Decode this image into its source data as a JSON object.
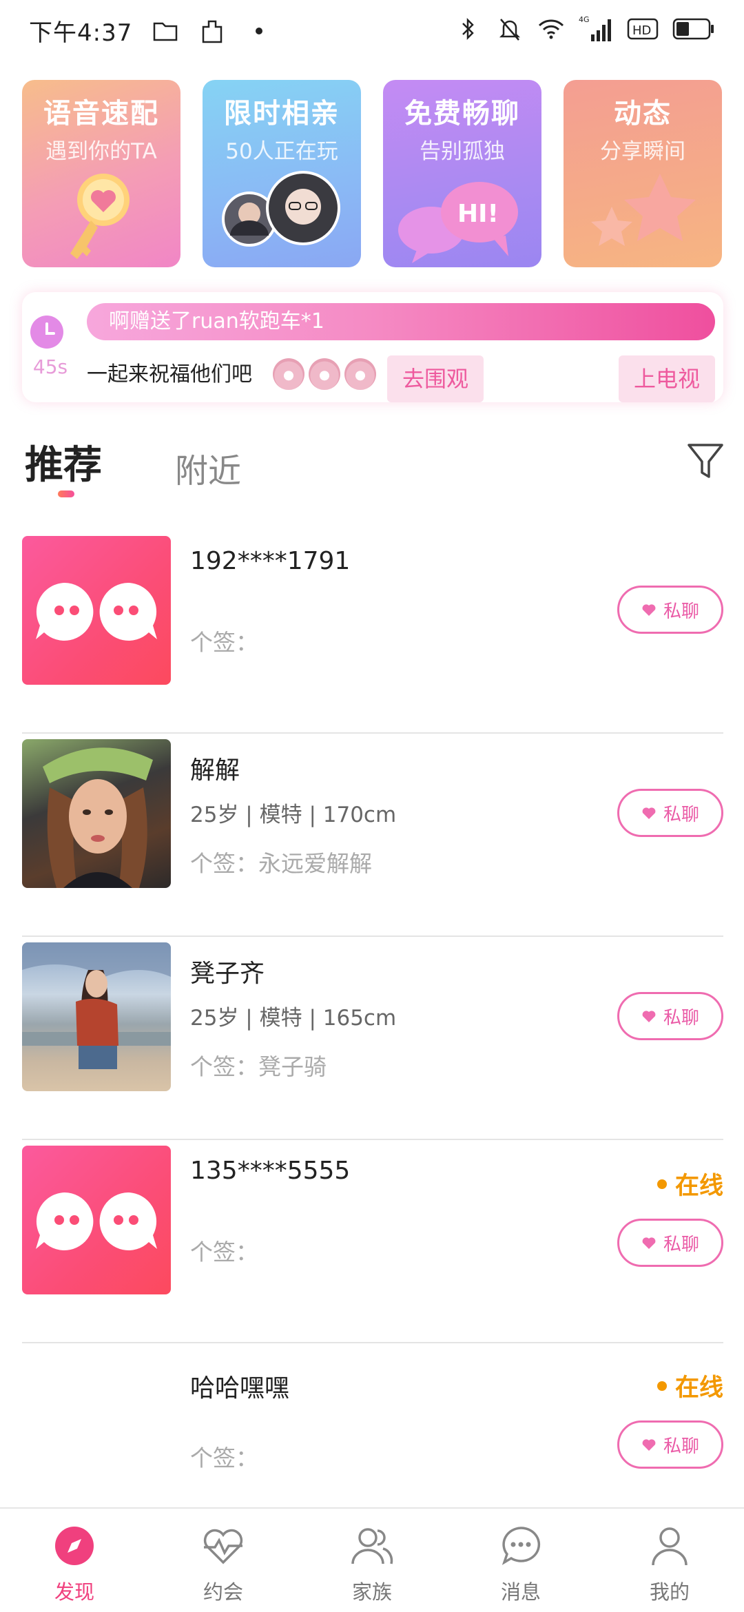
{
  "status_bar": {
    "time": "下午4:37",
    "network": "4G",
    "hd": "HD"
  },
  "features": [
    {
      "title": "语音速配",
      "subtitle": "遇到你的TA",
      "icon": "key-heart-icon"
    },
    {
      "title": "限时相亲",
      "subtitle": "50人正在玩",
      "icon": "couple-avatars-icon"
    },
    {
      "title": "免费畅聊",
      "subtitle": "告别孤独",
      "icon": "chat-bubbles-icon",
      "bubble_text": "HI!"
    },
    {
      "title": "动态",
      "subtitle": "分享瞬间",
      "icon": "stars-icon"
    }
  ],
  "banner": {
    "timer": "45s",
    "message": "啊赠送了ruan软跑车*1",
    "blessing": "一起来祝福他们吧",
    "watch_label": "去围观",
    "tv_label": "上电视"
  },
  "tabs": [
    {
      "label": "推荐",
      "active": true
    },
    {
      "label": "附近",
      "active": false
    }
  ],
  "list": [
    {
      "name": "192****1791",
      "meta": "",
      "signature": "个签：",
      "avatar": "app-logo",
      "online": false,
      "chat_label": "私聊"
    },
    {
      "name": "解解",
      "meta": "25岁 | 模特 | 170cm",
      "signature": "个签：永远爱解解",
      "avatar": "photo",
      "online": false,
      "chat_label": "私聊"
    },
    {
      "name": "凳子齐",
      "meta": "25岁 | 模特 | 165cm",
      "signature": "个签：凳子骑",
      "avatar": "photo",
      "online": false,
      "chat_label": "私聊"
    },
    {
      "name": "135****5555",
      "meta": "",
      "signature": "个签：",
      "avatar": "app-logo",
      "online": true,
      "online_label": "在线",
      "chat_label": "私聊"
    },
    {
      "name": "哈哈嘿嘿",
      "meta": "",
      "signature": "个签：",
      "avatar": "none",
      "online": true,
      "online_label": "在线",
      "chat_label": "私聊"
    }
  ],
  "nav": [
    {
      "label": "发现",
      "icon": "compass-icon",
      "active": true
    },
    {
      "label": "约会",
      "icon": "heartbeat-icon",
      "active": false
    },
    {
      "label": "家族",
      "icon": "group-icon",
      "active": false
    },
    {
      "label": "消息",
      "icon": "message-icon",
      "active": false
    },
    {
      "label": "我的",
      "icon": "person-icon",
      "active": false
    }
  ],
  "colors": {
    "accent": "#f0407e",
    "online": "#f39800",
    "chat_border": "#ef6cb0"
  }
}
